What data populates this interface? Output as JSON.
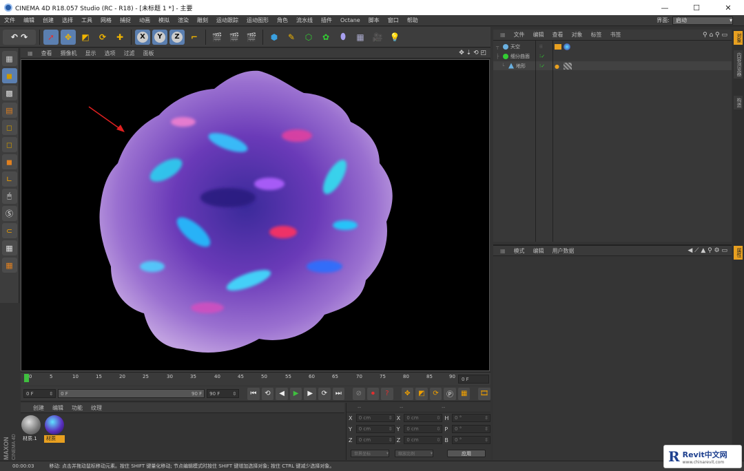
{
  "window": {
    "title": "CINEMA 4D R18.057 Studio (RC - R18) - [未标题 1 *] - 主要",
    "minimize": "—",
    "maximize": "☐",
    "close": "✕"
  },
  "menu": {
    "items": [
      "文件",
      "编辑",
      "创建",
      "选择",
      "工具",
      "网格",
      "捕捉",
      "动画",
      "模拟",
      "渲染",
      "雕刻",
      "运动跟踪",
      "运动图形",
      "角色",
      "流水线",
      "插件",
      "Octane",
      "脚本",
      "窗口",
      "帮助"
    ],
    "layout_label": "界面:",
    "layout_value": "启动"
  },
  "viewport": {
    "menu": [
      "查看",
      "摄像机",
      "显示",
      "选项",
      "过滤",
      "面板"
    ],
    "nav_icons": "✥ ⇣ ⟲ ◰"
  },
  "timeline": {
    "ticks": [
      "0",
      "5",
      "10",
      "15",
      "20",
      "25",
      "30",
      "35",
      "40",
      "45",
      "50",
      "55",
      "60",
      "65",
      "70",
      "75",
      "80",
      "85",
      "90"
    ],
    "current_frame": "0 F"
  },
  "transport": {
    "start_frame": "0 F",
    "preview_start": "0 F",
    "preview_end": "90 F",
    "end_frame": "90 F"
  },
  "materials": {
    "menu": [
      "创建",
      "编辑",
      "功能",
      "纹理"
    ],
    "items": [
      {
        "label": "材质.1"
      },
      {
        "label": "材质"
      }
    ]
  },
  "coordinates": {
    "headers": [
      "--",
      "--",
      "--"
    ],
    "rows": [
      {
        "a1": "X",
        "v1": "0 cm",
        "a2": "X",
        "v2": "0 cm",
        "a3": "H",
        "v3": "0 °"
      },
      {
        "a1": "Y",
        "v1": "0 cm",
        "a2": "Y",
        "v2": "0 cm",
        "a3": "P",
        "v3": "0 °"
      },
      {
        "a1": "Z",
        "v1": "0 cm",
        "a2": "Z",
        "v2": "0 cm",
        "a3": "B",
        "v3": "0 °"
      }
    ],
    "mode1": "世界坐标",
    "mode2": "缩放比例",
    "apply": "应用"
  },
  "objects": {
    "menu": [
      "文件",
      "编辑",
      "查看",
      "对象",
      "标签",
      "书签"
    ],
    "rows": [
      {
        "name": "天空",
        "indent": 0
      },
      {
        "name": "细分曲面",
        "indent": 0
      },
      {
        "name": "地形",
        "indent": 1
      }
    ]
  },
  "attributes": {
    "menu": [
      "模式",
      "编辑",
      "用户数据"
    ]
  },
  "right_tabs": [
    "对象",
    "内容浏览器",
    "构造",
    "属性"
  ],
  "status": {
    "time": "00:00:03",
    "message": "移动: 点击并拖动鼠标移动元素。按住 SHIFT 键量化移动; 节点编辑模式时按住 SHIFT 键增加选择对象; 按住 CTRL 键减少选择对象。"
  },
  "branding": {
    "maxon": "MAXON",
    "cinema": "CINEMA 4D",
    "watermark_title": "Revit中文网",
    "watermark_url": "www.chinarevit.com"
  },
  "colors": {
    "accent": "#5b7fb0",
    "timeline_marker": "#3fbf3f",
    "selected_material": "#e8a020"
  }
}
